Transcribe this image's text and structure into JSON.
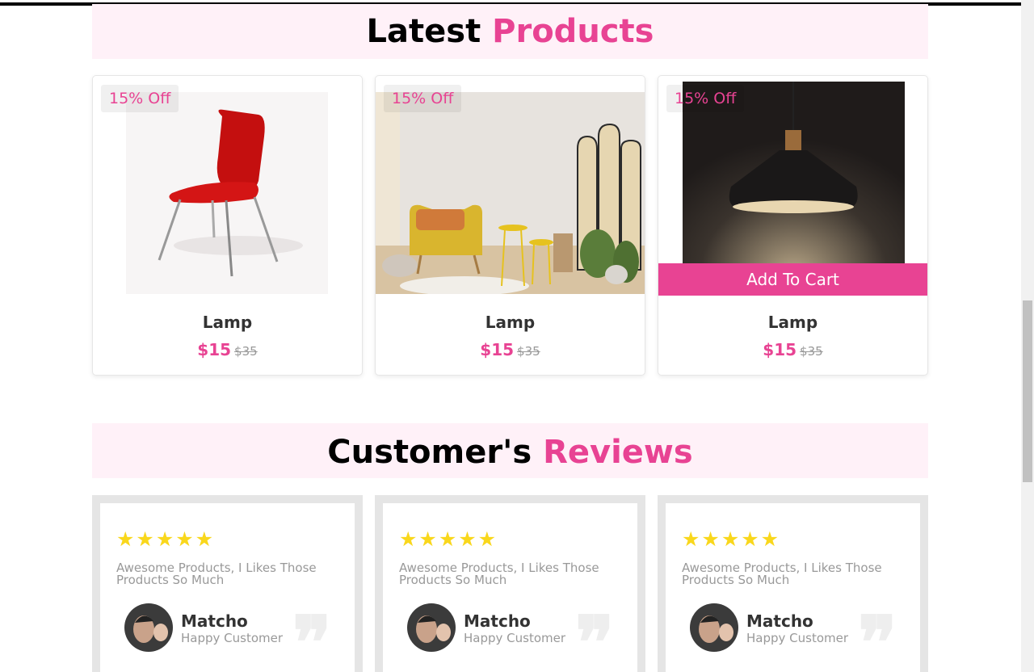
{
  "products_heading": {
    "part1": "Latest",
    "part2": "Products"
  },
  "reviews_heading": {
    "part1": "Customer's",
    "part2": "Reviews"
  },
  "products": [
    {
      "badge": "15% Off",
      "name": "Lamp",
      "price": "$15",
      "old_price": "$35",
      "image": "red-chair"
    },
    {
      "badge": "15% Off",
      "name": "Lamp",
      "price": "$15",
      "old_price": "$35",
      "image": "yellow-armchair-room"
    },
    {
      "badge": "15% Off",
      "name": "Lamp",
      "price": "$15",
      "old_price": "$35",
      "image": "pendant-lamp",
      "cart_label": "Add To Cart"
    }
  ],
  "reviews": [
    {
      "stars": "★★★★★",
      "text": "Awesome Products, I Likes Those Products So Much",
      "name": "Matcho",
      "role": "Happy Customer"
    },
    {
      "stars": "★★★★★",
      "text": "Awesome Products, I Likes Those Products So Much",
      "name": "Matcho",
      "role": "Happy Customer"
    },
    {
      "stars": "★★★★★",
      "text": "Awesome Products, I Likes Those Products So Much",
      "name": "Matcho",
      "role": "Happy Customer"
    }
  ],
  "colors": {
    "accent": "#e84393",
    "star": "#f9d71c",
    "heading_bg": "#fff1f8"
  }
}
